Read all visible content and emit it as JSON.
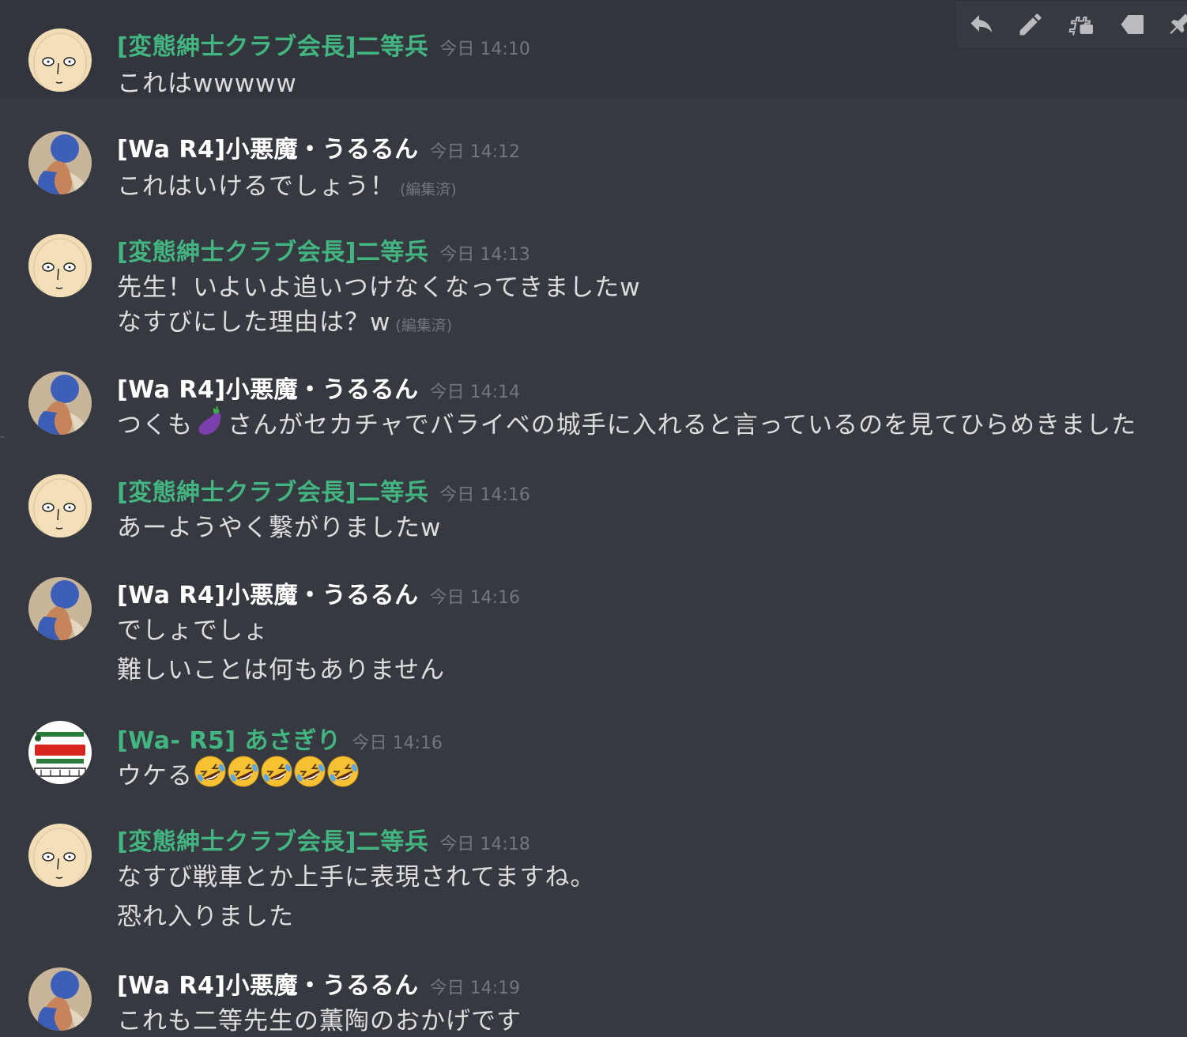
{
  "colors": {
    "background": "#36393f",
    "hover_background": "#32353b",
    "username_role_green": "#43b581",
    "username_white": "#ffffff",
    "timestamp": "#72767d",
    "message_text": "#dcddde"
  },
  "toolbar": {
    "icons": [
      "reply-icon",
      "edit-icon",
      "thread-icon",
      "tag-icon",
      "pin-icon"
    ]
  },
  "messages": [
    {
      "author": "[変態紳士クラブ会長]二等兵",
      "timestamp": "今日 14:10",
      "lines": [
        "これはwwwww"
      ]
    },
    {
      "author": "[Wa R4]小悪魔・うるるん",
      "timestamp": "今日 14:12",
      "lines": [
        "これはいけるでしょう！"
      ],
      "edited": "(編集済)"
    },
    {
      "author": "[変態紳士クラブ会長]二等兵",
      "timestamp": "今日 14:13",
      "lines": [
        "先生！いよいよ追いつけなくなってきましたw",
        "なすびにした理由は？w"
      ],
      "edited": "(編集済)"
    },
    {
      "author": "[Wa R4]小悪魔・うるるん",
      "timestamp": "今日 14:14",
      "line_before_emoji": "つくも",
      "line_after_emoji": "さんがセカチャでバライベの城手に入れると言っているのを見てひらめきました",
      "emoji": "eggplant-emoji"
    },
    {
      "author": "[変態紳士クラブ会長]二等兵",
      "timestamp": "今日 14:16",
      "lines": [
        "あーようやく繋がりましたw"
      ]
    },
    {
      "author": "[Wa R4]小悪魔・うるるん",
      "timestamp": "今日 14:16",
      "lines": [
        "でしょでしょ",
        "難しいことは何もありません"
      ]
    },
    {
      "author": "[Wa- R5] あさぎり",
      "timestamp": "今日 14:16",
      "lines": [
        "ウケる"
      ],
      "emoji": "rolling-on-floor-laughing-emoji",
      "emoji_count": 5,
      "avatar_sign": "あさぎり牛乳"
    },
    {
      "author": "[変態紳士クラブ会長]二等兵",
      "timestamp": "今日 14:18",
      "lines": [
        "なすび戦車とか上手に表現されてますね。",
        "恐れ入りました"
      ]
    },
    {
      "author": "[Wa R4]小悪魔・うるるん",
      "timestamp": "今日 14:19",
      "lines": [
        "これも二等先生の薫陶のおかげです"
      ]
    }
  ]
}
